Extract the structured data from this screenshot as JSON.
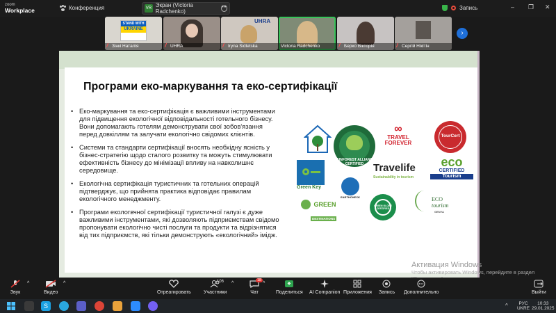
{
  "app": {
    "brand_top": "zoom",
    "brand_bottom": "Workplace"
  },
  "topbar": {
    "meeting_label": "Конференция",
    "screen_badge": "VR",
    "screen_label": "Экран (Victoria Radchenko)",
    "record_label": "Запись",
    "window_controls": [
      "–",
      "❐",
      "✕"
    ]
  },
  "participants": [
    {
      "name": "Зінкі Наталія",
      "muted": true,
      "bg": "#d9d6cf"
    },
    {
      "name": "UHRA",
      "muted": true,
      "bg": "#9a8f88"
    },
    {
      "name": "Iryna Sidletska",
      "muted": true,
      "bg": "#cfc8c0"
    },
    {
      "name": "Victoria Radchenko",
      "muted": false,
      "bg": "#7f8b76",
      "active": true
    },
    {
      "name": "Берко Вікторія",
      "muted": true,
      "bg": "#c7c3c2"
    },
    {
      "name": "Сергій Нікітін",
      "muted": true,
      "bg": "#a4a09c"
    }
  ],
  "tile_overlays": {
    "stand_with": "STAND WITH",
    "ukraine": "UKRAINE",
    "uhra": "UHRA"
  },
  "slide": {
    "title": "Програми еко-маркування та еко-сертифікації",
    "bullets": [
      "Еко-маркування та еко-сертифікація є важливими інструментами для підвищення екологічної відповідальності готельного бізнесу. Вони допомагають готелям демонструвати свої зобов'язання перед довкіллям та залучати екологічно свідомих клієнтів.",
      "Системи та стандарти сертифікації вносять необхідну ясність у бізнес-стратегію щодо сталого розвитку та можуть стимулювати ефективність бізнесу до мінімізації впливу на навколишнє середовище.",
      "Екологічна сертифікація туристичних та готельних операцій підтверджує, що прийнята практика відповідає правилам екологічного менеджменту.",
      "Програми екологвчної сертифікації туристичної галузі є дуже важливими інструментами, які дозволяють підприємствам свідомо пропонувати екологічно чисті послуги та продукти та відрізнятися від тих підприємств, які тільки демонструють «екологічний» імідж."
    ],
    "logos": {
      "rainforest": "RAINFOREST ALLIANCE CERTIFIED",
      "travel_forever_1": "TRAVEL",
      "travel_forever_2": "FOREVER",
      "tourcert": "TourCert",
      "green_key": "Green Key",
      "earthcheck": "EARTHCHECK",
      "travelife": "Travelife",
      "travelife_sub": "Sustainability in tourism",
      "eco_1": "eco",
      "eco_2": "CERTIFIED",
      "eco_3": "Tourism",
      "green_dest_1": "GREEN",
      "green_dest_2": "DESTINATIONS",
      "green_globe": "GREEN GLOBE CERTIFIED",
      "ecotourism_1": "ECO",
      "ecotourism_2": "tourism",
      "ecotourism_3": "GENYA"
    }
  },
  "watermark": {
    "title": "Активация Windows",
    "line": "Чтобы активировать Windows, перейдите в раздел \"Параметры\"."
  },
  "toolbar": {
    "mic": "Звук",
    "video": "Видео",
    "react": "Отреагировать",
    "participants": "Участники",
    "participants_count": "106",
    "chat": "Чат",
    "chat_badge": "18",
    "share": "Поделиться",
    "ai": "AI Companion",
    "apps": "Приложения",
    "record": "Запись",
    "more": "Дополнительно",
    "leave": "Выйти"
  },
  "taskbar": {
    "lang_1": "РУС",
    "lang_2": "UKRE",
    "time": "10:33",
    "date": "29.01.2025",
    "skype_letter": "S"
  },
  "colors": {
    "accent_green": "#39c35a",
    "zoom_blue": "#1e6fd9",
    "leave_red": "#e53935"
  }
}
